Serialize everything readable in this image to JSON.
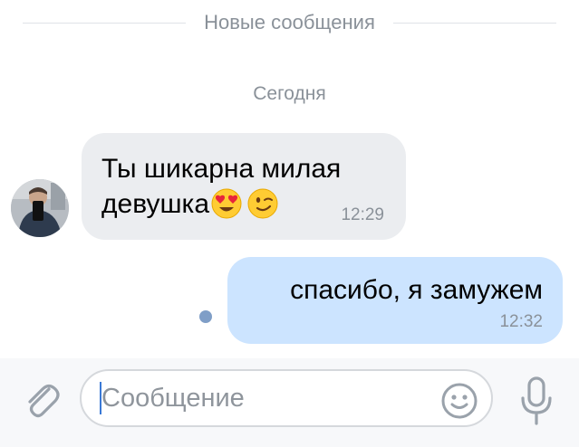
{
  "divider": {
    "label": "Новые сообщения"
  },
  "date": {
    "label": "Сегодня"
  },
  "messages": [
    {
      "direction": "incoming",
      "text": "Ты шикарна милая девушка",
      "emojis": [
        "heart-eyes-emoji",
        "winking-face-emoji"
      ],
      "time": "12:29"
    },
    {
      "direction": "outgoing",
      "text": "спасибо, я замужем",
      "time": "12:32",
      "status": "unread"
    }
  ],
  "input": {
    "placeholder": "Сообщение",
    "value": ""
  },
  "icons": {
    "attach": "paperclip-icon",
    "emoji": "smiley-icon",
    "mic": "microphone-icon"
  },
  "colors": {
    "incoming_bubble": "#ebedf0",
    "outgoing_bubble": "#cce4ff",
    "secondary_text": "#8a9199",
    "unread_dot": "#7f9ec7",
    "accent": "#3a79d6"
  }
}
